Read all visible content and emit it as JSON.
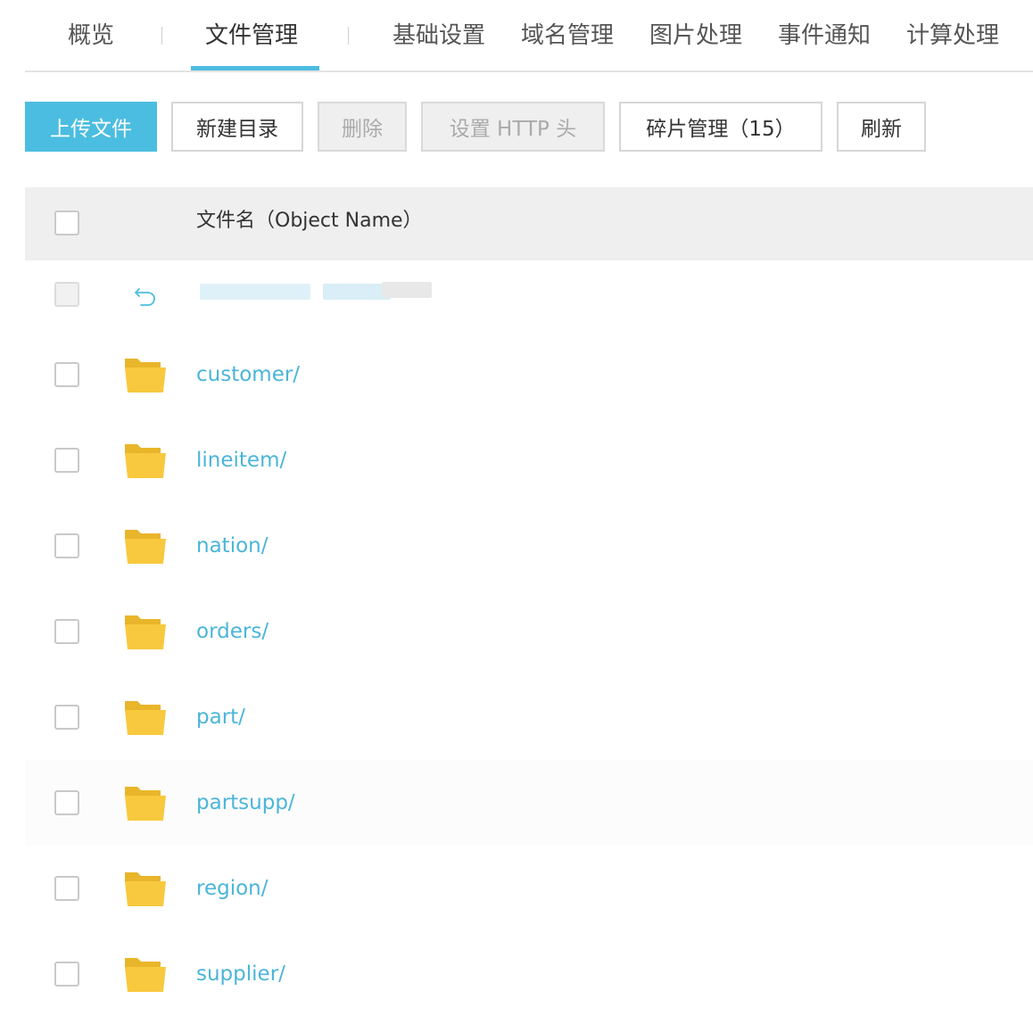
{
  "tabs": [
    {
      "label": "概览"
    },
    {
      "label": "文件管理",
      "active": true
    },
    {
      "label": "基础设置"
    },
    {
      "label": "域名管理"
    },
    {
      "label": "图片处理"
    },
    {
      "label": "事件通知"
    },
    {
      "label": "计算处理"
    }
  ],
  "toolbar": {
    "upload": "上传文件",
    "new_dir": "新建目录",
    "delete": "删除",
    "http_header": "设置 HTTP 头",
    "fragments": "碎片管理（15）",
    "refresh": "刷新"
  },
  "table": {
    "header_name": "文件名（Object Name）",
    "rows": [
      {
        "name": "customer/"
      },
      {
        "name": "lineitem/"
      },
      {
        "name": "nation/"
      },
      {
        "name": "orders/"
      },
      {
        "name": "part/"
      },
      {
        "name": "partsupp/"
      },
      {
        "name": "region/"
      },
      {
        "name": "supplier/"
      }
    ]
  },
  "colors": {
    "accent": "#4bbde0",
    "link": "#4bb5d9",
    "folder": "#f8c93e",
    "header_bg": "#efefef"
  },
  "icons": {
    "back": "return-arrow-icon",
    "folder": "folder-open-icon"
  }
}
